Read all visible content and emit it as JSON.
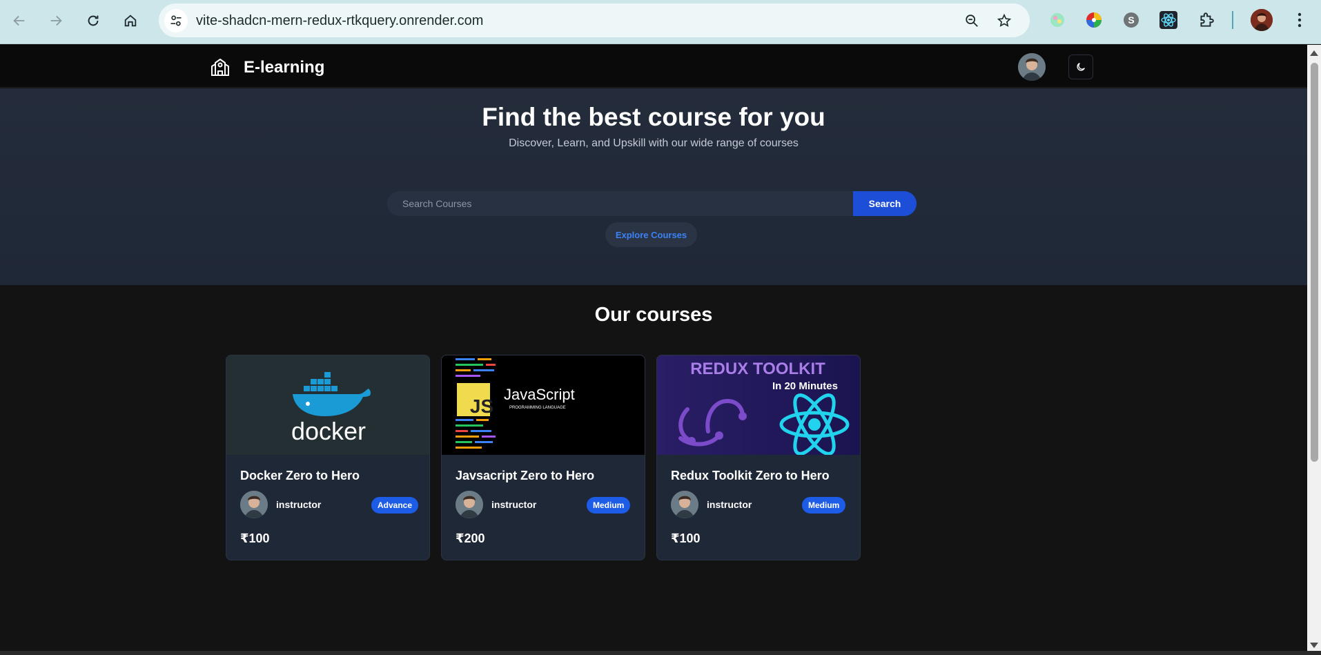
{
  "browser": {
    "url": "vite-shadcn-mern-redux-rtkquery.onrender.com"
  },
  "header": {
    "brand": "E-learning"
  },
  "hero": {
    "title": "Find the best course for you",
    "subtitle": "Discover, Learn, and Upskill with our wide range of courses",
    "search_placeholder": "Search Courses",
    "search_button": "Search",
    "explore_button": "Explore Courses"
  },
  "courses": {
    "title": "Our courses",
    "items": [
      {
        "title": "Docker Zero to Hero",
        "instructor": "instructor",
        "level": "Advance",
        "price": "₹100",
        "thumb_text": "docker"
      },
      {
        "title": "Javsacript Zero to Hero",
        "instructor": "instructor",
        "level": "Medium",
        "price": "₹200",
        "thumb_text": "JavaScript",
        "thumb_badge": "JS",
        "thumb_sub": "PROGRAMMING LANGUAGE"
      },
      {
        "title": "Redux Toolkit Zero to Hero",
        "instructor": "instructor",
        "level": "Medium",
        "price": "₹100",
        "thumb_text": "REDUX TOOLKIT",
        "thumb_sub": "In 20 Minutes"
      }
    ]
  },
  "colors": {
    "accent": "#1d4ed8",
    "badge": "#1d5ce6",
    "hero_bg": "#222b3a",
    "card_bg": "#1f2837",
    "page_bg": "#131313"
  }
}
